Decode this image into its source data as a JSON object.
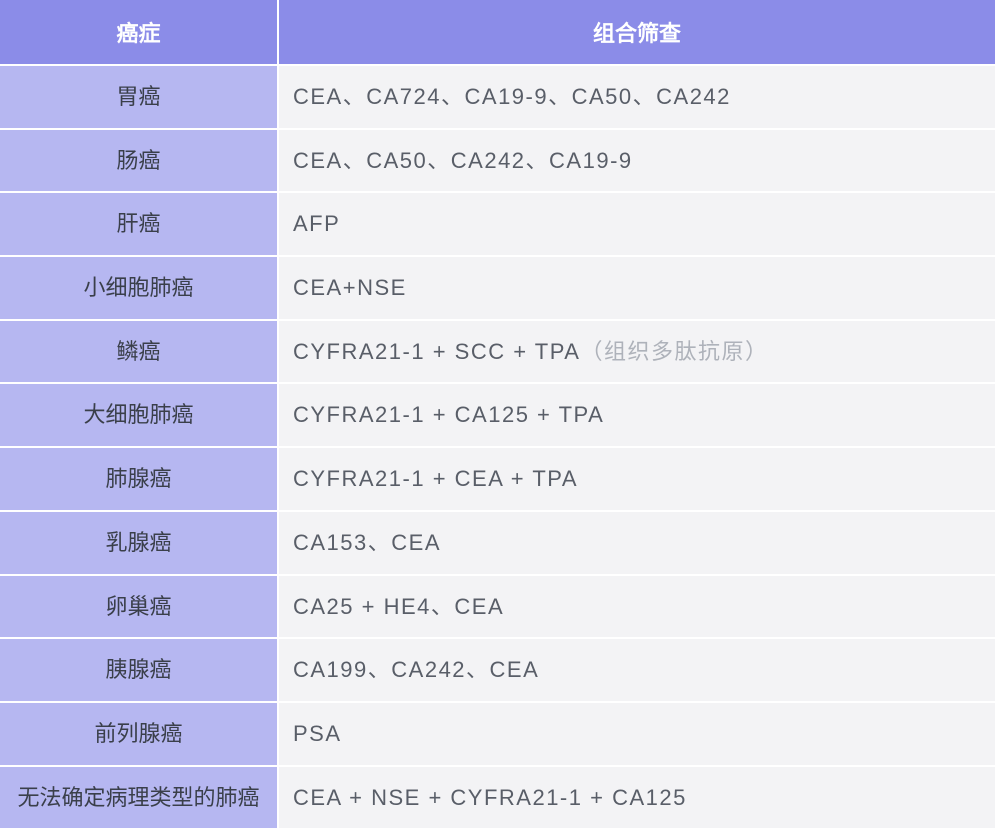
{
  "headers": {
    "cancer": "癌症",
    "screening": "组合筛查"
  },
  "rows": [
    {
      "cancer": "胃癌",
      "screening": "CEA、CA724、CA19-9、CA50、CA242",
      "note": ""
    },
    {
      "cancer": "肠癌",
      "screening": "CEA、CA50、CA242、CA19-9",
      "note": ""
    },
    {
      "cancer": "肝癌",
      "screening": "AFP",
      "note": ""
    },
    {
      "cancer": "小细胞肺癌",
      "screening": "CEA+NSE",
      "note": ""
    },
    {
      "cancer": "鳞癌",
      "screening": "CYFRA21-1 + SCC + TPA",
      "note": "（组织多肽抗原）"
    },
    {
      "cancer": "大细胞肺癌",
      "screening": "CYFRA21-1 + CA125 + TPA",
      "note": ""
    },
    {
      "cancer": "肺腺癌",
      "screening": "CYFRA21-1 + CEA + TPA",
      "note": ""
    },
    {
      "cancer": "乳腺癌",
      "screening": "CA153、CEA",
      "note": ""
    },
    {
      "cancer": "卵巢癌",
      "screening": "CA25 + HE4、CEA",
      "note": ""
    },
    {
      "cancer": "胰腺癌",
      "screening": "CA199、CA242、CEA",
      "note": ""
    },
    {
      "cancer": "前列腺癌",
      "screening": "PSA",
      "note": ""
    },
    {
      "cancer": "无法确定病理类型的肺癌",
      "screening": "CEA + NSE + CYFRA21-1 + CA125",
      "note": ""
    }
  ]
}
